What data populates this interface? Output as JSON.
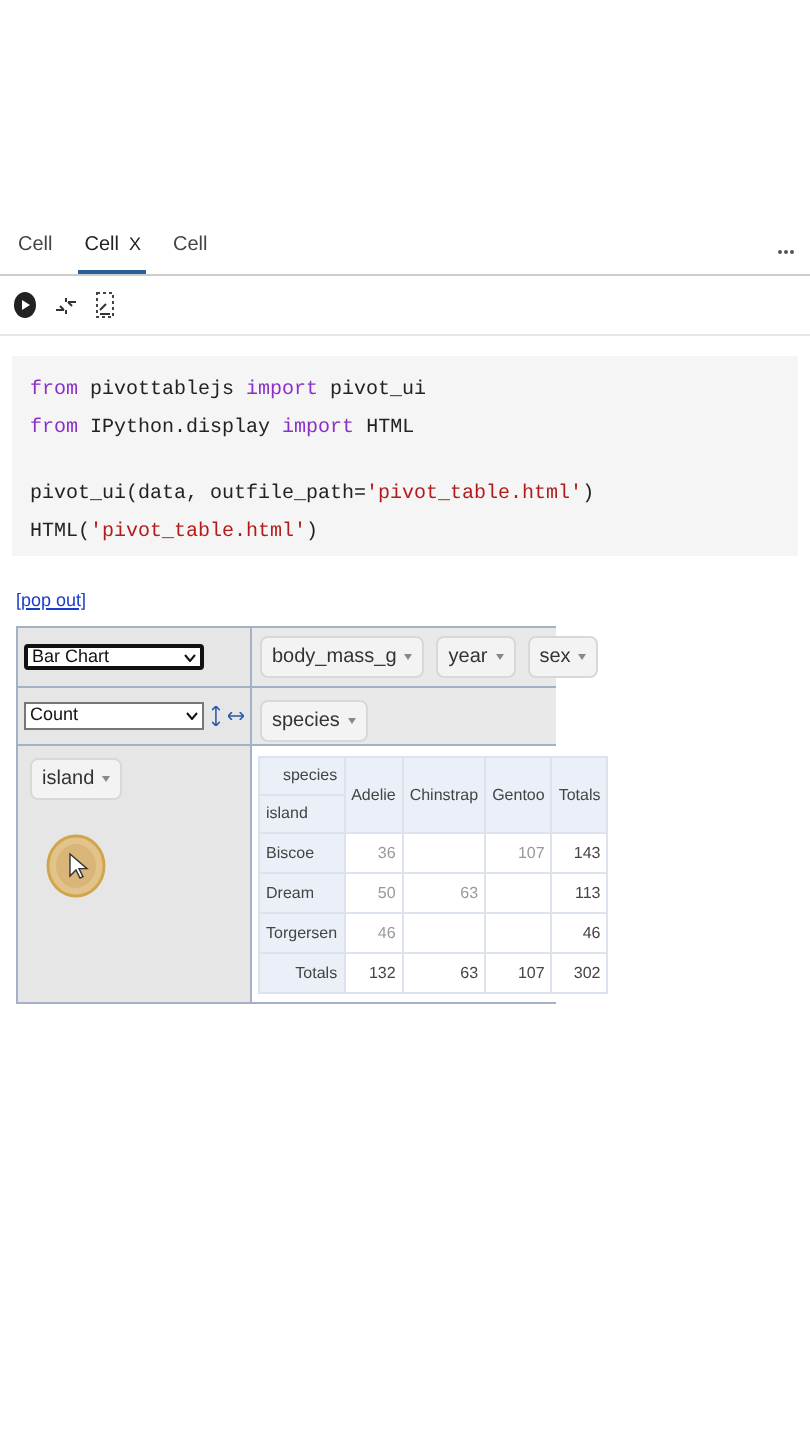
{
  "tabs": [
    {
      "label": "Cell",
      "selected": false
    },
    {
      "label": "Cell",
      "selected": true,
      "close": "X"
    },
    {
      "label": "Cell",
      "selected": false
    }
  ],
  "code": {
    "blocks": [
      [
        [
          {
            "kind": "keyword",
            "text": "from"
          },
          {
            "kind": "plain",
            "text": " pivottablejs "
          },
          {
            "kind": "keyword",
            "text": "import"
          },
          {
            "kind": "plain",
            "text": " pivot_ui"
          }
        ],
        [
          {
            "kind": "keyword",
            "text": "from"
          },
          {
            "kind": "plain",
            "text": " IPython.display "
          },
          {
            "kind": "keyword",
            "text": "import"
          },
          {
            "kind": "plain",
            "text": " HTML"
          }
        ]
      ],
      [
        [
          {
            "kind": "plain",
            "text": "pivot_ui(data, outfile_path="
          },
          {
            "kind": "string",
            "text": "'pivot_table.html'"
          },
          {
            "kind": "plain",
            "text": ")"
          }
        ],
        [
          {
            "kind": "plain",
            "text": "HTML("
          },
          {
            "kind": "string",
            "text": "'pivot_table.html'"
          },
          {
            "kind": "plain",
            "text": ")"
          }
        ]
      ]
    ]
  },
  "pop_out_link": "[pop out]",
  "pivot": {
    "renderer": "Bar Chart",
    "aggregator": "Count",
    "unused_attributes": [
      "body_mass_g",
      "year",
      "sex"
    ],
    "column_attributes": [
      "species"
    ],
    "row_attributes": [
      "island"
    ],
    "table": {
      "column_attribute": "species",
      "row_attribute": "island",
      "columns": [
        "Adelie",
        "Chinstrap",
        "Gentoo",
        "Totals"
      ],
      "rows": [
        {
          "label": "Biscoe",
          "cells": [
            "36",
            null,
            "107",
            "143"
          ]
        },
        {
          "label": "Dream",
          "cells": [
            "50",
            "63",
            null,
            "113"
          ]
        },
        {
          "label": "Torgersen",
          "cells": [
            "46",
            null,
            null,
            "46"
          ]
        }
      ],
      "totals": {
        "label": "Totals",
        "cells": [
          "132",
          "63",
          "107",
          "302"
        ]
      }
    }
  }
}
